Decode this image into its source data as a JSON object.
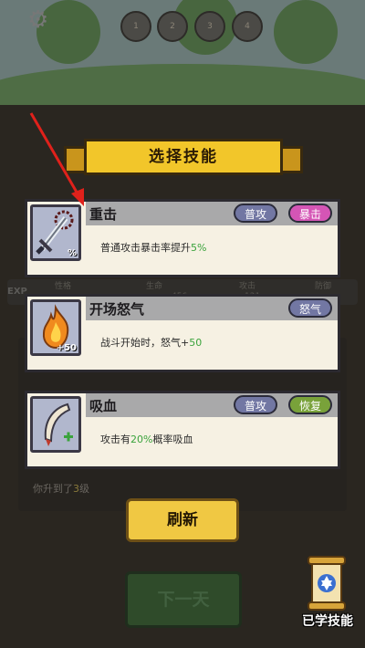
{
  "dialog": {
    "title": "选择技能",
    "skills": [
      {
        "name": "重击",
        "icon": "sword-icon",
        "badge": "%",
        "tags": [
          "普攻",
          "暴击"
        ],
        "desc_prefix": "普通攻击暴击率提升",
        "desc_highlight": "5%",
        "desc_suffix": ""
      },
      {
        "name": "开场怒气",
        "icon": "flame-icon",
        "badge": "+50",
        "tags": [
          "怒气"
        ],
        "desc_prefix": "战斗开始时，怒气+",
        "desc_highlight": "50",
        "desc_suffix": ""
      },
      {
        "name": "吸血",
        "icon": "fang-icon",
        "badge": "+",
        "tags": [
          "普攻",
          "恢复"
        ],
        "desc_prefix": "攻击有",
        "desc_highlight": "20%",
        "desc_suffix": "概率吸血"
      }
    ],
    "refresh_label": "刷新"
  },
  "background": {
    "exp_label": "EXP",
    "stats": [
      "性格",
      "生命",
      "攻击",
      "防御"
    ],
    "stat_values": [
      "",
      "456",
      "121",
      ""
    ],
    "log_prefix": "你升到了",
    "log_level": "3",
    "log_suffix": "级",
    "next_day_label": "下一天"
  },
  "learned_skills": {
    "label": "已学技能",
    "icon": "scroll-icon"
  },
  "colors": {
    "highlight": "#3aa33c",
    "ribbon": "#f2c62a",
    "crit_tag": "#d455b5",
    "heal_tag": "#79a23a",
    "normal_tag": "#7277a3",
    "arrow": "#e0211b"
  }
}
